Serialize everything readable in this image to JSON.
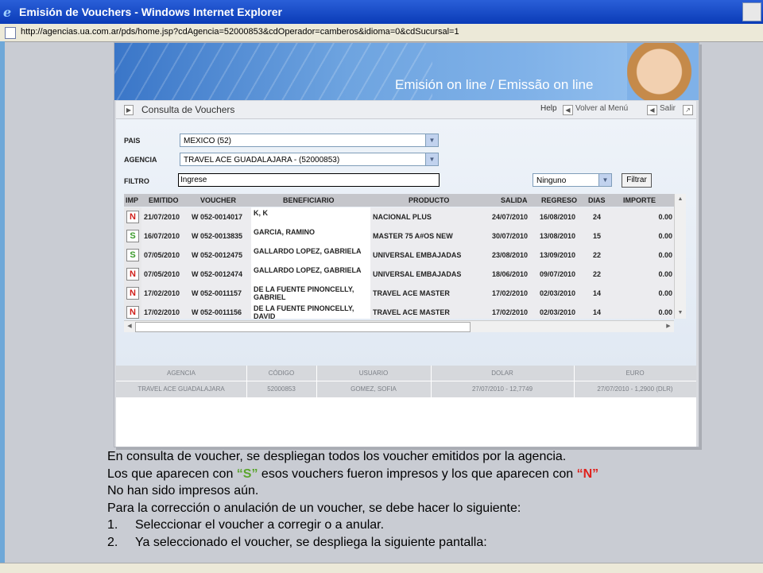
{
  "window": {
    "title": "Emisión de Vouchers - Windows Internet Explorer",
    "url": "http://agencias.ua.com.ar/pds/home.jsp?cdAgencia=52000853&cdOperador=camberos&idioma=0&cdSucursal=1"
  },
  "banner": {
    "title": "Emisión on line / Emissão on line"
  },
  "panel": {
    "title": "Consulta de Vouchers",
    "help": "Help",
    "volver": "Volver al Menú",
    "salir": "Salir"
  },
  "form": {
    "pais_label": "PAIS",
    "pais_value": "MEXICO (52)",
    "agencia_label": "AGENCIA",
    "agencia_value": "TRAVEL ACE GUADALAJARA - (52000853)",
    "filtro_label": "FILTRO",
    "filtro_value": "Ingrese",
    "ninguno_value": "Ninguno",
    "filtrar_button": "Filtrar"
  },
  "table": {
    "headers": {
      "imp": "IMP",
      "emitido": "EMITIDO",
      "voucher": "VOUCHER",
      "beneficiario": "BENEFICIARIO",
      "producto": "PRODUCTO",
      "salida": "SALIDA",
      "regreso": "REGRESO",
      "dias": "DIAS",
      "importe": "IMPORTE"
    },
    "rows": [
      {
        "imp": "N",
        "emitido": "21/07/2010",
        "voucher": "W 052-0014017",
        "beneficiario": "K, K",
        "producto": "NACIONAL PLUS",
        "salida": "24/07/2010",
        "regreso": "16/08/2010",
        "dias": "24",
        "importe": "0.00"
      },
      {
        "imp": "S",
        "emitido": "16/07/2010",
        "voucher": "W 052-0013835",
        "beneficiario": "GARCIA, RAMINO",
        "producto": "MASTER 75 A#OS NEW",
        "salida": "30/07/2010",
        "regreso": "13/08/2010",
        "dias": "15",
        "importe": "0.00"
      },
      {
        "imp": "S",
        "emitido": "07/05/2010",
        "voucher": "W 052-0012475",
        "beneficiario": "GALLARDO LOPEZ, GABRIELA",
        "producto": "UNIVERSAL EMBAJADAS",
        "salida": "23/08/2010",
        "regreso": "13/09/2010",
        "dias": "22",
        "importe": "0.00"
      },
      {
        "imp": "N",
        "emitido": "07/05/2010",
        "voucher": "W 052-0012474",
        "beneficiario": "GALLARDO LOPEZ, GABRIELA",
        "producto": "UNIVERSAL EMBAJADAS",
        "salida": "18/06/2010",
        "regreso": "09/07/2010",
        "dias": "22",
        "importe": "0.00"
      },
      {
        "imp": "N",
        "emitido": "17/02/2010",
        "voucher": "W 052-0011157",
        "beneficiario": "DE LA FUENTE PINONCELLY, GABRIEL",
        "producto": "TRAVEL ACE MASTER",
        "salida": "17/02/2010",
        "regreso": "02/03/2010",
        "dias": "14",
        "importe": "0.00"
      },
      {
        "imp": "N",
        "emitido": "17/02/2010",
        "voucher": "W 052-0011156",
        "beneficiario": "DE LA FUENTE PINONCELLY, DAVID",
        "producto": "TRAVEL ACE MASTER",
        "salida": "17/02/2010",
        "regreso": "02/03/2010",
        "dias": "14",
        "importe": "0.00"
      }
    ]
  },
  "info": {
    "headers": [
      "AGENCIA",
      "CÓDIGO",
      "USUARIO",
      "DOLAR",
      "EURO"
    ],
    "values": [
      "TRAVEL ACE GUADALAJARA",
      "52000853",
      "GOMEZ, SOFIA",
      "27/07/2010 - 12,7749",
      "27/07/2010 - 1,2900 (DLR)"
    ]
  },
  "notes": {
    "line1": "En consulta de voucher, se despliegan todos los voucher emitidos por la agencia.",
    "line2_a": "Los que aparecen con ",
    "line2_s": "“S”",
    "line2_b": " esos vouchers fueron impresos y los que aparecen con ",
    "line2_n": "“N”",
    "line3": "No han sido impresos aún.",
    "line4": "Para la corrección o anulación de un voucher, se debe hacer lo siguiente:",
    "items": [
      {
        "num": "1.",
        "text": "Seleccionar el voucher a corregir o a anular."
      },
      {
        "num": "2.",
        "text": "Ya seleccionado el voucher, se despliega la siguiente pantalla:"
      }
    ]
  },
  "colors": {
    "imp_S": "#3a9a2a",
    "imp_N": "#d0201b"
  }
}
